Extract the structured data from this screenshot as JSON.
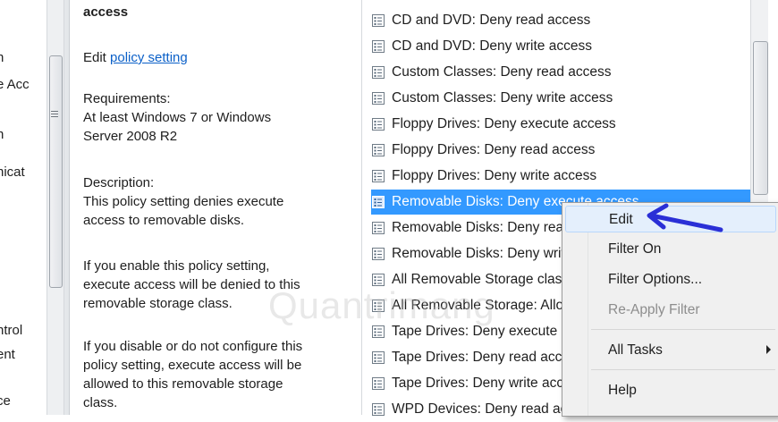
{
  "tree": {
    "fragments": [
      {
        "text": "n"
      },
      {
        "text": "e Acc"
      },
      {
        "text": "n"
      },
      {
        "text": "nicat"
      },
      {
        "text": "ntrol"
      },
      {
        "text": "ent"
      },
      {
        "text": "ce"
      }
    ]
  },
  "description": {
    "title": "access",
    "edit_prefix": "Edit ",
    "edit_link": "policy setting",
    "requirements_label": "Requirements:",
    "requirements_line1": "At least Windows 7 or Windows",
    "requirements_line2": "Server 2008 R2",
    "description_label": "Description:",
    "desc_line1": "This policy setting denies execute",
    "desc_line2": "access to removable disks.",
    "enable_line1": "If you enable this policy setting,",
    "enable_line2": "execute access will be denied to this",
    "enable_line3": "removable storage class.",
    "disable_line1": "If you disable or do not configure this",
    "disable_line2": "policy setting, execute access will be",
    "disable_line3": "allowed to this removable storage",
    "disable_line4": "class."
  },
  "policies": [
    {
      "label": "CD and DVD: Deny read access"
    },
    {
      "label": "CD and DVD: Deny write access"
    },
    {
      "label": "Custom Classes: Deny read access"
    },
    {
      "label": "Custom Classes: Deny write access"
    },
    {
      "label": "Floppy Drives: Deny execute access"
    },
    {
      "label": "Floppy Drives: Deny read access"
    },
    {
      "label": "Floppy Drives: Deny write access"
    },
    {
      "label": "Removable Disks: Deny execute access",
      "selected": true
    },
    {
      "label": "Removable Disks: Deny read access"
    },
    {
      "label": "Removable Disks: Deny write access"
    },
    {
      "label": "All Removable Storage classes: Deny all access"
    },
    {
      "label": "All Removable Storage: Allow direct access in remote sessions"
    },
    {
      "label": "Tape Drives: Deny execute access"
    },
    {
      "label": "Tape Drives: Deny read access"
    },
    {
      "label": "Tape Drives: Deny write access"
    },
    {
      "label": "WPD Devices: Deny read access"
    }
  ],
  "context_menu": {
    "edit": "Edit",
    "filter_on": "Filter On",
    "filter_options": "Filter Options...",
    "reapply_filter": "Re-Apply Filter",
    "all_tasks": "All Tasks",
    "help": "Help"
  },
  "watermark": "Quantrimang",
  "colors": {
    "selection": "#3399ff",
    "link": "#0b60c8",
    "annotation_arrow": "#2a2fd6",
    "menu_bg": "#f0f0f0"
  }
}
